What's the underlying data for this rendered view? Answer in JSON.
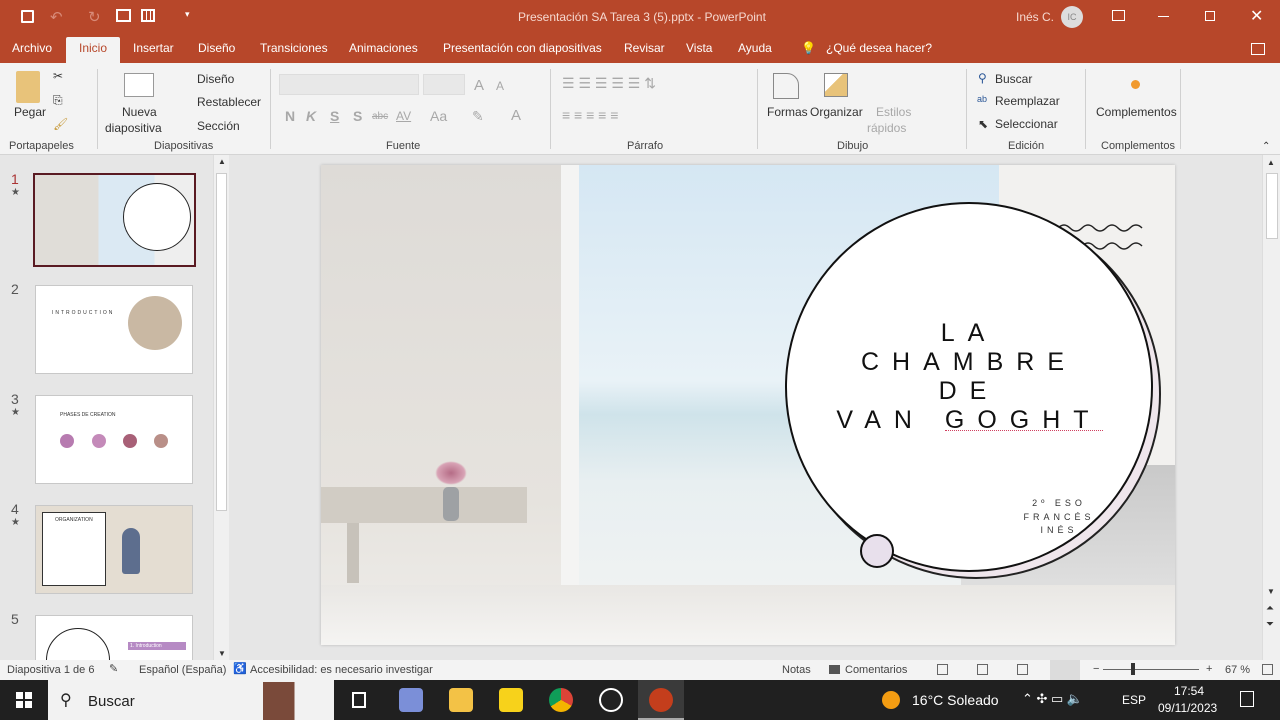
{
  "window": {
    "title": "Presentación SA Tarea 3 (5).pptx  -  PowerPoint",
    "user": "Inés C.",
    "user_initials": "IC"
  },
  "tabs": [
    "Archivo",
    "Inicio",
    "Insertar",
    "Diseño",
    "Transiciones",
    "Animaciones",
    "Presentación con diapositivas",
    "Revisar",
    "Vista",
    "Ayuda"
  ],
  "tell_me": "¿Qué desea hacer?",
  "ribbon": {
    "clipboard": {
      "paste": "Pegar",
      "group": "Portapapeles"
    },
    "slides": {
      "new_slide_1": "Nueva",
      "new_slide_2": "diapositiva",
      "layout": "Diseño",
      "reset": "Restablecer",
      "section": "Sección",
      "group": "Diapositivas"
    },
    "font": {
      "bold": "N",
      "italic": "K",
      "underline": "S",
      "shadow": "S",
      "strike": "abc",
      "spacing": "AV",
      "case": "Aa",
      "grow": "A",
      "shrink": "A",
      "color": "A",
      "group": "Fuente"
    },
    "paragraph": {
      "group": "Párrafo"
    },
    "drawing": {
      "shapes": "Formas",
      "arrange": "Organizar",
      "styles_1": "Estilos",
      "styles_2": "rápidos",
      "group": "Dibujo"
    },
    "editing": {
      "find": "Buscar",
      "replace": "Reemplazar",
      "select": "Seleccionar",
      "group": "Edición"
    },
    "addins": {
      "label": "Complementos",
      "group": "Complementos"
    }
  },
  "thumbnails": [
    {
      "num": "1",
      "star": true,
      "selected": true
    },
    {
      "num": "2",
      "star": false,
      "heading": "INTRODUCTION"
    },
    {
      "num": "3",
      "star": true,
      "heading": "PHASES DE CREATION"
    },
    {
      "num": "4",
      "star": true,
      "heading": "ORGANIZATION"
    },
    {
      "num": "5",
      "star": false,
      "item": "1. Introduction"
    }
  ],
  "slide": {
    "title_lines": [
      "LA",
      "CHAMBRE",
      "DE",
      "VAN GOGHT"
    ],
    "subtitle_lines": [
      "2º ESO",
      "FRANCÉS",
      "INÉS"
    ]
  },
  "status": {
    "slide_info": "Diapositiva 1 de 6",
    "language": "Español (España)",
    "accessibility": "Accesibilidad: es necesario investigar",
    "notes": "Notas",
    "comments": "Comentarios",
    "zoom": "67 %",
    "zoom_level": 0.67
  },
  "taskbar": {
    "search": "Buscar",
    "weather": "16°C  Soleado",
    "lang": "ESP",
    "time": "17:54",
    "date": "09/11/2023"
  },
  "colors": {
    "accent": "#b7472a",
    "slide_circle_fill": "#ffffff",
    "knob": "#e8e0ec"
  }
}
